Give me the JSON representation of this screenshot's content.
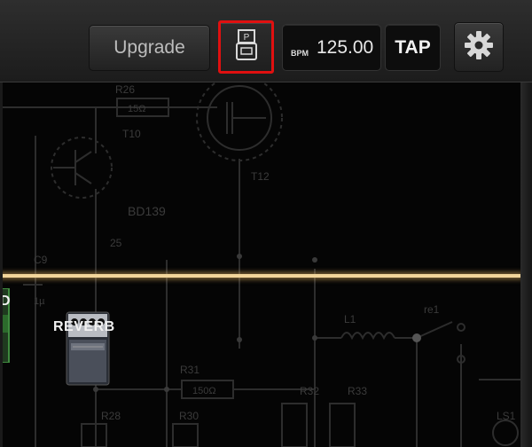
{
  "toolbar": {
    "upgrade_label": "Upgrade",
    "pedal_mode_icon": "pedal-board-icon",
    "bpm_label": "BPM",
    "bpm_value": "125.00",
    "tap_label": "TAP",
    "settings_icon": "gear-icon",
    "highlight_color": "#e01010"
  },
  "canvas": {
    "pedal_label": "REVERB",
    "partial_label": "D",
    "cable_color": "#f2d49a",
    "schematic": {
      "labels": [
        "R26",
        "15Ω",
        "T10",
        "T12",
        "BD139",
        "C9",
        "1µ",
        "25",
        "L1",
        "re1",
        "R31",
        "150Ω",
        "R28",
        "R30",
        "R32",
        "R33",
        "LS1"
      ]
    }
  }
}
